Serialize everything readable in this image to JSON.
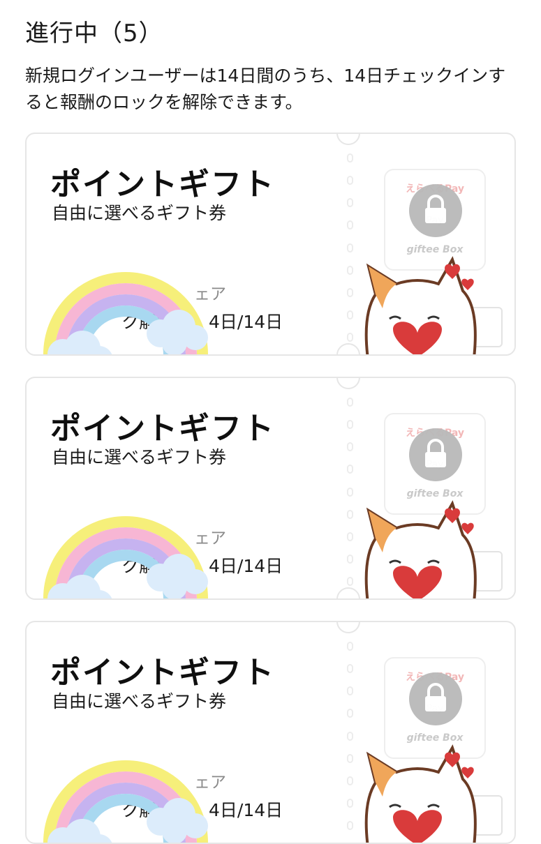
{
  "section": {
    "title": "進行中（5）",
    "description": "新規ログインユーザーは14日間のうち、14日チェックインすると報酬のロックを解除できます。"
  },
  "cards": [
    {
      "title": "ポイントギフト",
      "subtitle": "自由に選べるギフト券",
      "share_label": "ェア",
      "progress": "ク解除　　4日/14日"
    },
    {
      "title": "ポイントギフト",
      "subtitle": "自由に選べるギフト券",
      "share_label": "ェア",
      "progress": "ク解除　　4日/14日"
    },
    {
      "title": "ポイントギフト",
      "subtitle": "自由に選べるギフト券",
      "share_label": "ェア",
      "progress": "ク解除　　4日/14日"
    }
  ],
  "logos": {
    "line1": "えらべるPay",
    "line2": "Pay",
    "line3": "giftee Box"
  },
  "icons": {
    "lock": "lock-icon",
    "rainbow": "rainbow-sticker",
    "cat": "cat-sticker"
  },
  "colors": {
    "lock_bg": "#b9b9b9",
    "card_border": "#e6e6e6",
    "heart": "#d93b3b"
  }
}
